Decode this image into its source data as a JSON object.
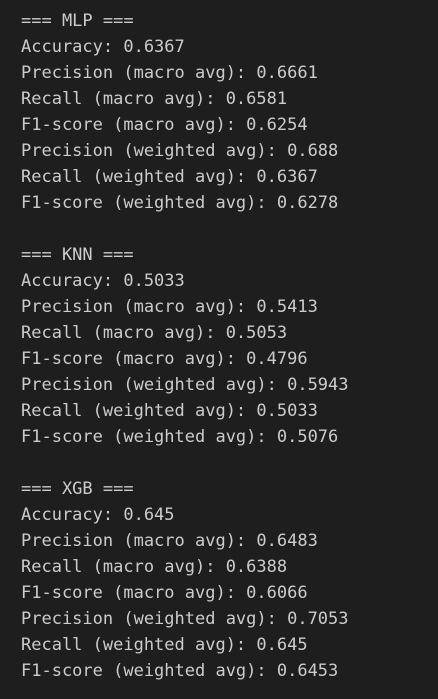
{
  "output": {
    "blocks": [
      {
        "header": "=== MLP ===",
        "lines": [
          "Accuracy: 0.6367",
          "Precision (macro avg): 0.6661",
          "Recall (macro avg): 0.6581",
          "F1-score (macro avg): 0.6254",
          "Precision (weighted avg): 0.688",
          "Recall (weighted avg): 0.6367",
          "F1-score (weighted avg): 0.6278"
        ]
      },
      {
        "header": "=== KNN ===",
        "lines": [
          "Accuracy: 0.5033",
          "Precision (macro avg): 0.5413",
          "Recall (macro avg): 0.5053",
          "F1-score (macro avg): 0.4796",
          "Precision (weighted avg): 0.5943",
          "Recall (weighted avg): 0.5033",
          "F1-score (weighted avg): 0.5076"
        ]
      },
      {
        "header": "=== XGB ===",
        "lines": [
          "Accuracy: 0.645",
          "Precision (macro avg): 0.6483",
          "Recall (macro avg): 0.6388",
          "F1-score (macro avg): 0.6066",
          "Precision (weighted avg): 0.7053",
          "Recall (weighted avg): 0.645",
          "F1-score (weighted avg): 0.6453"
        ]
      }
    ]
  },
  "colors": {
    "background": "#1e1e1e",
    "text": "#cccccc"
  }
}
